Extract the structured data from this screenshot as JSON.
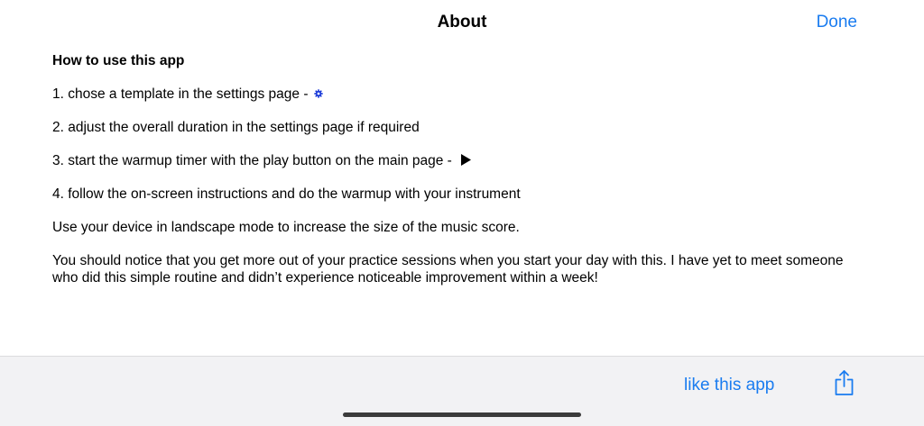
{
  "nav": {
    "title": "About",
    "done_label": "Done"
  },
  "content": {
    "heading": "How to use this app",
    "steps": [
      "1. chose a template in the settings page -",
      "2. adjust the overall duration in the settings page if required",
      "3. start the warmup timer with the play button on the main page -",
      "4. follow the on-screen instructions and do the warmup with your instrument"
    ],
    "landscape_tip": "Use your device in landscape mode to increase the size of the music score.",
    "closing": "You should notice that you get more out of your practice sessions when you start your day with this. I have yet to meet someone who did this simple routine and didn’t experience noticeable improvement within a week!"
  },
  "icons": {
    "settings": "gear-icon",
    "play": "play-icon",
    "share": "share-icon"
  },
  "toolbar": {
    "like_label": "like this app"
  },
  "colors": {
    "accent": "#1a7cf0",
    "gear": "#1a3ad8",
    "toolbar_bg": "#f2f2f4"
  }
}
